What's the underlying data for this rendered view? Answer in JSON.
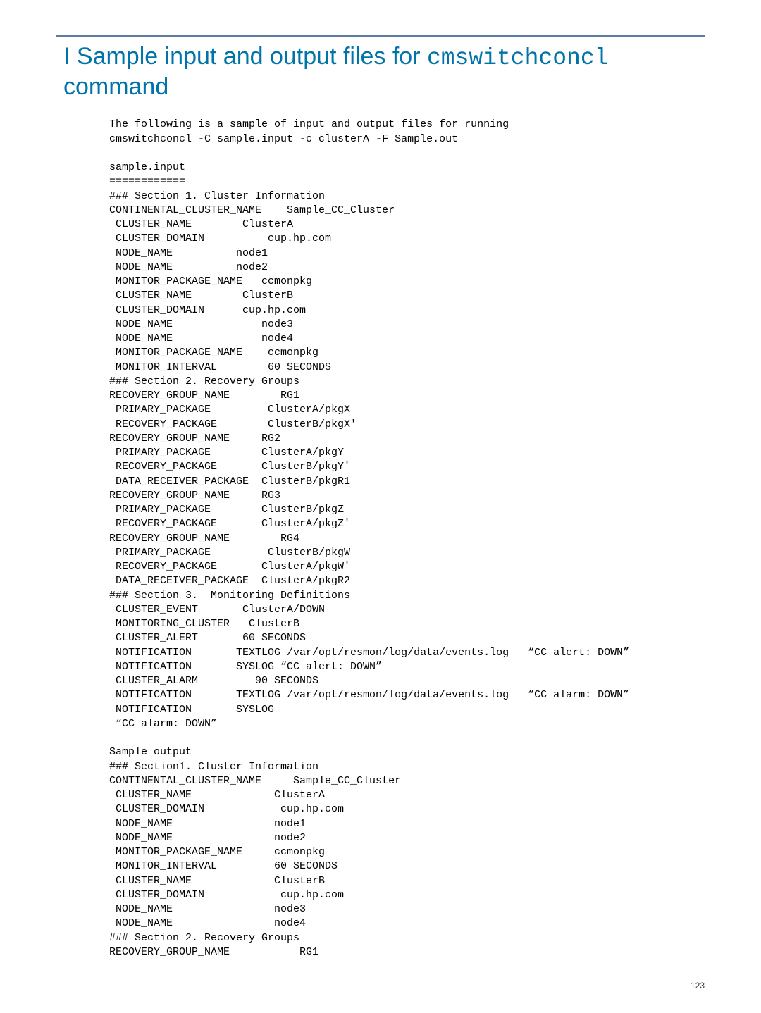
{
  "title": {
    "prefix": "I Sample input and output files for ",
    "code": "cmswitchconcl",
    "suffix": "command"
  },
  "intro_line1": "The following is a sample of input and output files for running",
  "intro_line2": "cmswitchconcl -C sample.input -c clusterA -F Sample.out",
  "sample_input_label": "sample.input",
  "divider": "============",
  "sec1_header": "### Section 1. Cluster Information",
  "sec1_body": "CONTINENTAL_CLUSTER_NAME    Sample_CC_Cluster\n CLUSTER_NAME        ClusterA\n CLUSTER_DOMAIN          cup.hp.com\n NODE_NAME          node1\n NODE_NAME          node2\n MONITOR_PACKAGE_NAME   ccmonpkg\n CLUSTER_NAME        ClusterB\n CLUSTER_DOMAIN      cup.hp.com\n NODE_NAME              node3\n NODE_NAME              node4\n MONITOR_PACKAGE_NAME    ccmonpkg\n MONITOR_INTERVAL        60 SECONDS",
  "sec2_header": "### Section 2. Recovery Groups",
  "sec2_body": "RECOVERY_GROUP_NAME        RG1\n PRIMARY_PACKAGE         ClusterA/pkgX\n RECOVERY_PACKAGE        ClusterB/pkgX'\nRECOVERY_GROUP_NAME     RG2\n PRIMARY_PACKAGE        ClusterA/pkgY\n RECOVERY_PACKAGE       ClusterB/pkgY'\n DATA_RECEIVER_PACKAGE  ClusterB/pkgR1\nRECOVERY_GROUP_NAME     RG3\n PRIMARY_PACKAGE        ClusterB/pkgZ\n RECOVERY_PACKAGE       ClusterA/pkgZ'\nRECOVERY_GROUP_NAME        RG4\n PRIMARY_PACKAGE         ClusterB/pkgW\n RECOVERY_PACKAGE       ClusterA/pkgW'\n DATA_RECEIVER_PACKAGE  ClusterA/pkgR2",
  "sec3_header": "### Section 3.  Monitoring Definitions",
  "sec3_body": " CLUSTER_EVENT       ClusterA/DOWN\n MONITORING_CLUSTER   ClusterB\n CLUSTER_ALERT       60 SECONDS\n NOTIFICATION       TEXTLOG /var/opt/resmon/log/data/events.log   “CC alert: DOWN”\n NOTIFICATION       SYSLOG “CC alert: DOWN”\n CLUSTER_ALARM         90 SECONDS\n NOTIFICATION       TEXTLOG /var/opt/resmon/log/data/events.log   “CC alarm: DOWN”\n NOTIFICATION       SYSLOG\n “CC alarm: DOWN”",
  "sample_output_label": "Sample output",
  "out_sec1_header": "### Section1. Cluster Information",
  "out_sec1_body": "CONTINENTAL_CLUSTER_NAME     Sample_CC_Cluster\n CLUSTER_NAME             ClusterA\n CLUSTER_DOMAIN            cup.hp.com\n NODE_NAME                node1\n NODE_NAME                node2\n MONITOR_PACKAGE_NAME     ccmonpkg\n MONITOR_INTERVAL         60 SECONDS\n CLUSTER_NAME             ClusterB\n CLUSTER_DOMAIN            cup.hp.com\n NODE_NAME                node3\n NODE_NAME                node4",
  "out_sec2_header": "### Section 2. Recovery Groups",
  "out_sec2_body": "RECOVERY_GROUP_NAME           RG1",
  "page_number": "123"
}
